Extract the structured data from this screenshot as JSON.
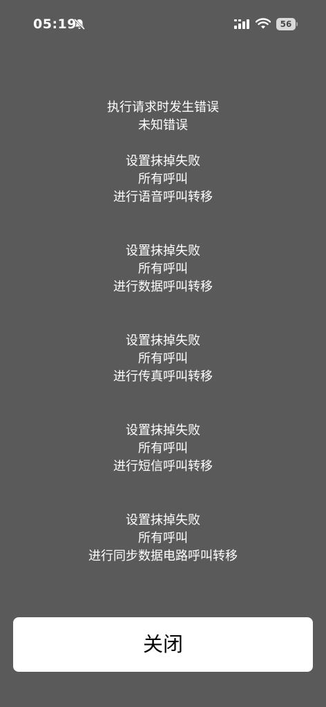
{
  "status_bar": {
    "time": "05:19",
    "battery": "56",
    "icons": [
      "bell-slash-icon",
      "signal-icon",
      "wifi-icon",
      "battery-icon"
    ]
  },
  "message": {
    "title": "执行请求时发生错误",
    "subtitle": "未知错误",
    "blocks": [
      {
        "line1": "设置抹掉失败",
        "line2": "所有呼叫",
        "line3": "进行语音呼叫转移"
      },
      {
        "line1": "设置抹掉失败",
        "line2": "所有呼叫",
        "line3": "进行数据呼叫转移"
      },
      {
        "line1": "设置抹掉失败",
        "line2": "所有呼叫",
        "line3": "进行传真呼叫转移"
      },
      {
        "line1": "设置抹掉失败",
        "line2": "所有呼叫",
        "line3": "进行短信呼叫转移"
      },
      {
        "line1": "设置抹掉失败",
        "line2": "所有呼叫",
        "line3": "进行同步数据电路呼叫转移"
      }
    ]
  },
  "close_button": {
    "label": "关闭"
  }
}
